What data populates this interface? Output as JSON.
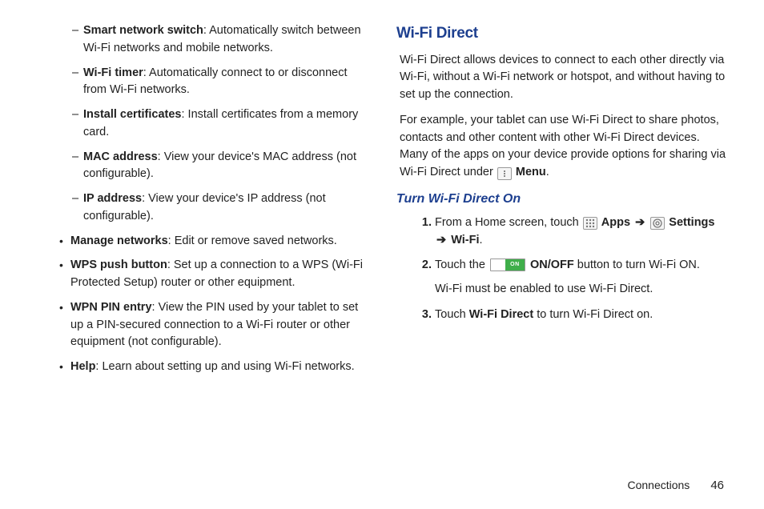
{
  "left": {
    "dash": [
      {
        "term": "Smart network switch",
        "desc": ": Automatically switch between Wi-Fi networks and mobile networks."
      },
      {
        "term": "Wi-Fi timer",
        "desc": ": Automatically connect to or disconnect from Wi-Fi networks."
      },
      {
        "term": "Install certificates",
        "desc": ": Install certificates from a memory card."
      },
      {
        "term": "MAC address",
        "desc": ": View your device's MAC address (not configurable)."
      },
      {
        "term": "IP address",
        "desc": ": View your device's IP address (not configurable)."
      }
    ],
    "bullets": [
      {
        "term": "Manage networks",
        "desc": ": Edit or remove saved networks."
      },
      {
        "term": "WPS push button",
        "desc": ": Set up a connection to a WPS (Wi-Fi Protected Setup) router or other equipment."
      },
      {
        "term": "WPN PIN entry",
        "desc": ": View the PIN used by your tablet to set up a PIN-secured connection to a Wi-Fi router or other equipment (not configurable)."
      },
      {
        "term": "Help",
        "desc": ": Learn about setting up and using Wi-Fi networks."
      }
    ]
  },
  "right": {
    "h1": "Wi-Fi Direct",
    "p1": "Wi-Fi Direct allows devices to connect to each other directly via Wi-Fi, without a Wi-Fi network or hotspot, and without having to set up the connection.",
    "p2_a": "For example, your tablet can use Wi-Fi Direct to share photos, contacts and other content with other Wi-Fi Direct devices. Many of the apps on your device provide options for sharing via Wi-Fi Direct under ",
    "p2_menu": "Menu",
    "p2_b": ".",
    "h2": "Turn Wi-Fi Direct On",
    "s1_a": "From a Home screen, touch ",
    "s1_apps": "Apps",
    "s1_arrow": "➔",
    "s1_settings": "Settings",
    "s1_wifi": "Wi-Fi",
    "s1_c": ".",
    "s2_a": "Touch the ",
    "s2_on": "ON",
    "s2_label": "ON/OFF",
    "s2_b": " button to turn Wi-Fi ON.",
    "s2_sub": "Wi-Fi must be enabled to use Wi-Fi Direct.",
    "s3_a": "Touch ",
    "s3_term": "Wi-Fi Direct",
    "s3_b": " to turn Wi-Fi Direct on."
  },
  "footer": {
    "section": "Connections",
    "page": "46"
  }
}
